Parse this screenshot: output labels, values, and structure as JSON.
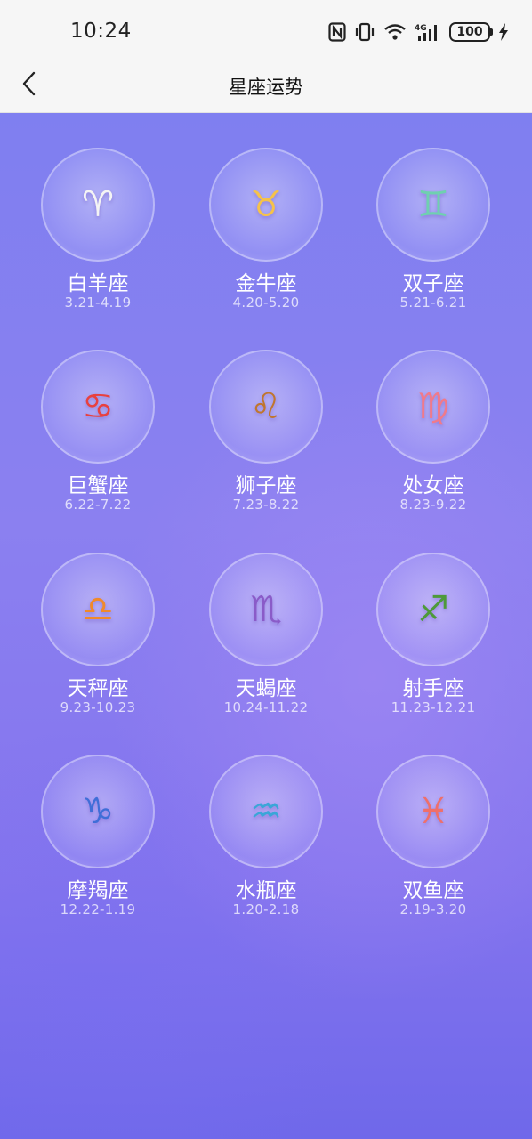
{
  "status_bar": {
    "time": "10:24",
    "battery": "100",
    "icons": [
      "nfc-icon",
      "vibrate-icon",
      "wifi-icon",
      "signal-4g-icon",
      "battery-icon",
      "charging-icon"
    ]
  },
  "header": {
    "title": "星座运势",
    "back_icon": "chevron-left-icon"
  },
  "colors": {
    "background_top": "#7f7ff0",
    "background_bottom": "#6f68ea",
    "text": "#ffffff"
  },
  "signs": [
    {
      "name": "白羊座",
      "dates": "3.21-4.19",
      "symbol": "♈",
      "accent": "#f4f4f4",
      "icon": "aries-mascot-icon"
    },
    {
      "name": "金牛座",
      "dates": "4.20-5.20",
      "symbol": "♉",
      "accent": "#f5c24a",
      "icon": "taurus-mascot-icon"
    },
    {
      "name": "双子座",
      "dates": "5.21-6.21",
      "symbol": "♊",
      "accent": "#6fd0b0",
      "icon": "gemini-mascot-icon"
    },
    {
      "name": "巨蟹座",
      "dates": "6.22-7.22",
      "symbol": "♋",
      "accent": "#e8413f",
      "icon": "cancer-mascot-icon"
    },
    {
      "name": "狮子座",
      "dates": "7.23-8.22",
      "symbol": "♌",
      "accent": "#c0762e",
      "icon": "leo-mascot-icon"
    },
    {
      "name": "处女座",
      "dates": "8.23-9.22",
      "symbol": "♍",
      "accent": "#f07a8a",
      "icon": "virgo-mascot-icon"
    },
    {
      "name": "天秤座",
      "dates": "9.23-10.23",
      "symbol": "♎",
      "accent": "#f08a2a",
      "icon": "libra-mascot-icon"
    },
    {
      "name": "天蝎座",
      "dates": "10.24-11.22",
      "symbol": "♏",
      "accent": "#8a5bc8",
      "icon": "scorpio-mascot-icon"
    },
    {
      "name": "射手座",
      "dates": "11.23-12.21",
      "symbol": "♐",
      "accent": "#4e9a3a",
      "icon": "sagittarius-mascot-icon"
    },
    {
      "name": "摩羯座",
      "dates": "12.22-1.19",
      "symbol": "♑",
      "accent": "#3f6ed8",
      "icon": "capricorn-mascot-icon"
    },
    {
      "name": "水瓶座",
      "dates": "1.20-2.18",
      "symbol": "♒",
      "accent": "#3aa6d8",
      "icon": "aquarius-mascot-icon"
    },
    {
      "name": "双鱼座",
      "dates": "2.19-3.20",
      "symbol": "♓",
      "accent": "#ef6f6a",
      "icon": "pisces-mascot-icon"
    }
  ]
}
